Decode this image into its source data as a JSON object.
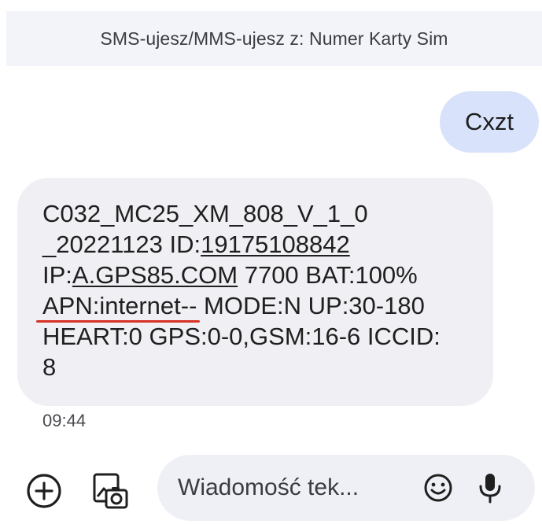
{
  "header": {
    "sim_label": "SMS-ujesz/MMS-ujesz z: Numer Karty Sim"
  },
  "messages": {
    "outgoing": {
      "text": "Cxzt"
    },
    "incoming": {
      "line1": "C032_MC25_XM_808_V_1_0",
      "line2_prefix": "_20221123 ID:",
      "line2_id": "19175108842",
      "line3_prefix": "IP:",
      "line3_host": "A.GPS85.COM",
      "line3_rest": " 7700 BAT:100%",
      "line4_apn": "APN:internet--",
      "line4_rest": " MODE:N UP:30-180",
      "line5": "HEART:0 GPS:0-0,GSM:16-6 ICCID:",
      "line6": "8",
      "time": "09:44"
    }
  },
  "composer": {
    "placeholder": "Wiadomość tek...",
    "icons": {
      "add": "add-circle-icon",
      "gallery": "gallery-icon",
      "emoji": "emoji-icon",
      "mic": "microphone-icon"
    }
  },
  "colors": {
    "banner_bg": "#f3f4f9",
    "outgoing_bubble": "#d8e2fb",
    "incoming_bubble": "#f0f0f4",
    "composer_bg": "#eef0f6",
    "spellcheck": "#d93025"
  }
}
